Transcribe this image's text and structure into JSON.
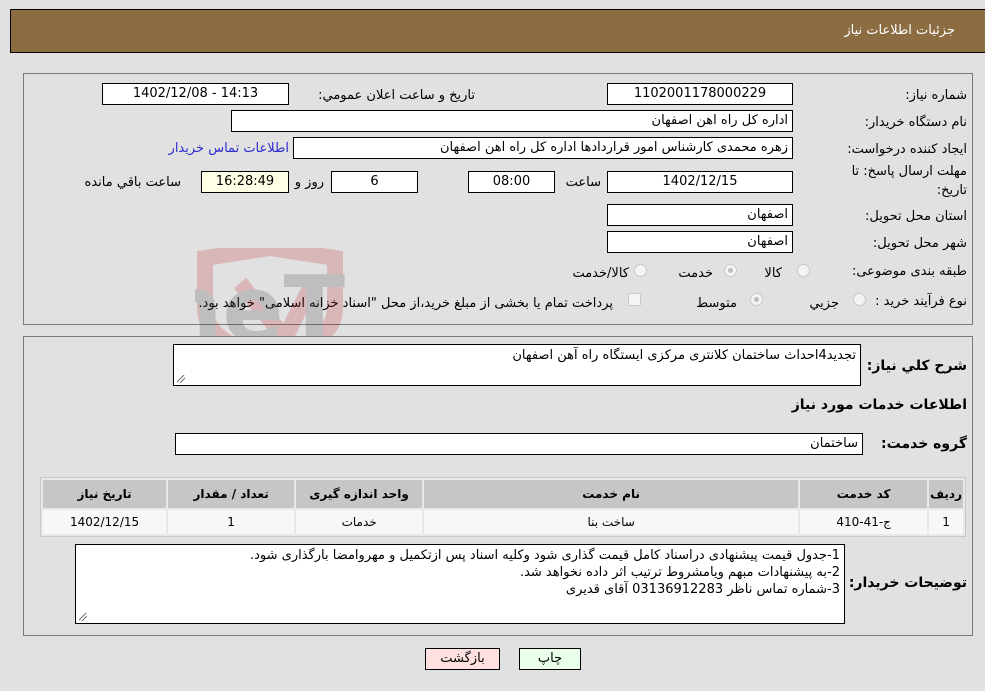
{
  "header": {
    "title": "جزئیات اطلاعات نیاز"
  },
  "form": {
    "need_number": {
      "label": "شماره نیاز:",
      "value": "1102001178000229"
    },
    "announce_datetime": {
      "label": "تاريخ و ساعت اعلان عمومي:",
      "value": "1402/12/08 - 14:13"
    },
    "buyer_org": {
      "label": "نام دستگاه خریدار:",
      "value": "اداره کل راه اهن اصفهان"
    },
    "requester": {
      "label": "ایجاد کننده درخواست:",
      "value": "زهره محمدی کارشناس امور قراردادها اداره کل راه اهن اصفهان"
    },
    "buyer_contact_link": "اطلاعات تماس خریدار",
    "deadline": {
      "label_line1": "مهلت ارسال پاسخ: تا",
      "label_line2": "تاریخ:",
      "date": "1402/12/15",
      "time_label": "ساعت",
      "time": "08:00",
      "days": "6",
      "days_label": "روز و",
      "remaining": "16:28:49",
      "remaining_label": "ساعت باقي مانده"
    },
    "province": {
      "label": "استان محل تحویل:",
      "value": "اصفهان"
    },
    "city": {
      "label": "شهر محل تحویل:",
      "value": "اصفهان"
    },
    "category": {
      "label": "طبقه بندی موضوعی:",
      "options": [
        "کالا",
        "خدمت",
        "کالا/خدمت"
      ],
      "selected": "خدمت"
    },
    "purchase_type": {
      "label": "نوع فرآیند خرید :",
      "options": [
        "جزيي",
        "متوسط"
      ],
      "selected": "متوسط",
      "treasury_note": "پرداخت تمام یا بخشی از مبلغ خرید،از محل \"اسناد خزانه اسلامی\" خواهد بود."
    }
  },
  "details": {
    "summary_label": "شرح كلي نياز:",
    "summary_value": "تجدید4احداث ساختمان کلانتری مرکزی ایستگاه راه آهن اصفهان",
    "services_heading": "اطلاعات خدمات مورد نياز",
    "service_group_label": "گروه خدمت:",
    "service_group_value": "ساختمان",
    "table": {
      "headers": [
        "رديف",
        "كد خدمت",
        "نام خدمت",
        "واحد اندازه گيری",
        "تعداد / مقدار",
        "تاريخ نياز"
      ],
      "rows": [
        [
          "1",
          "ج-41-410",
          "ساخت بنا",
          "خدمات",
          "1",
          "1402/12/15"
        ]
      ]
    },
    "buyer_notes_label": "توضیحات خریدار:",
    "buyer_notes": [
      "1-جدول قیمت پیشنهادی دراسناد کامل قیمت گذاری شود وکلیه اسناد پس ازتکمیل و مهروامضا بارگذاری شود.",
      "2-به پیشنهادات مبهم ویامشروط ترتیب اثر داده نخواهد شد.",
      "3-شماره تماس ناظر 03136912283 آقای قدیری"
    ]
  },
  "buttons": {
    "print": "چاپ",
    "back": "بازگشت"
  },
  "watermark": {
    "text": "AriaTender.neT"
  },
  "colors": {
    "header_bg": "#8c6d42",
    "link": "#2b2bd1",
    "print_bg": "#eaffea",
    "back_bg": "#ffe0e0"
  }
}
